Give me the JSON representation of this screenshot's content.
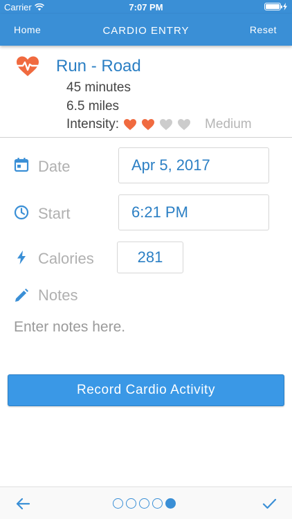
{
  "status_bar": {
    "carrier": "Carrier",
    "time": "7:07 PM"
  },
  "nav": {
    "home_label": "Home",
    "title": "CARDIO ENTRY",
    "reset_label": "Reset"
  },
  "summary": {
    "activity": "Run - Road",
    "duration": "45 minutes",
    "distance": "6.5 miles",
    "intensity_label": "Intensity:",
    "intensity_rating": 2,
    "intensity_max": 4,
    "intensity_level": "Medium"
  },
  "form": {
    "date_label": "Date",
    "date_value": "Apr 5, 2017",
    "start_label": "Start",
    "start_value": "6:21 PM",
    "calories_label": "Calories",
    "calories_value": "281",
    "notes_label": "Notes",
    "notes_placeholder": "Enter notes here."
  },
  "record_button_label": "Record Cardio Activity",
  "pager": {
    "count": 5,
    "active_index": 4
  },
  "colors": {
    "primary": "#3a8fd6",
    "heart_active": "#f06a3f",
    "heart_inactive": "#cccccc",
    "value_text": "#2b7fc4"
  }
}
